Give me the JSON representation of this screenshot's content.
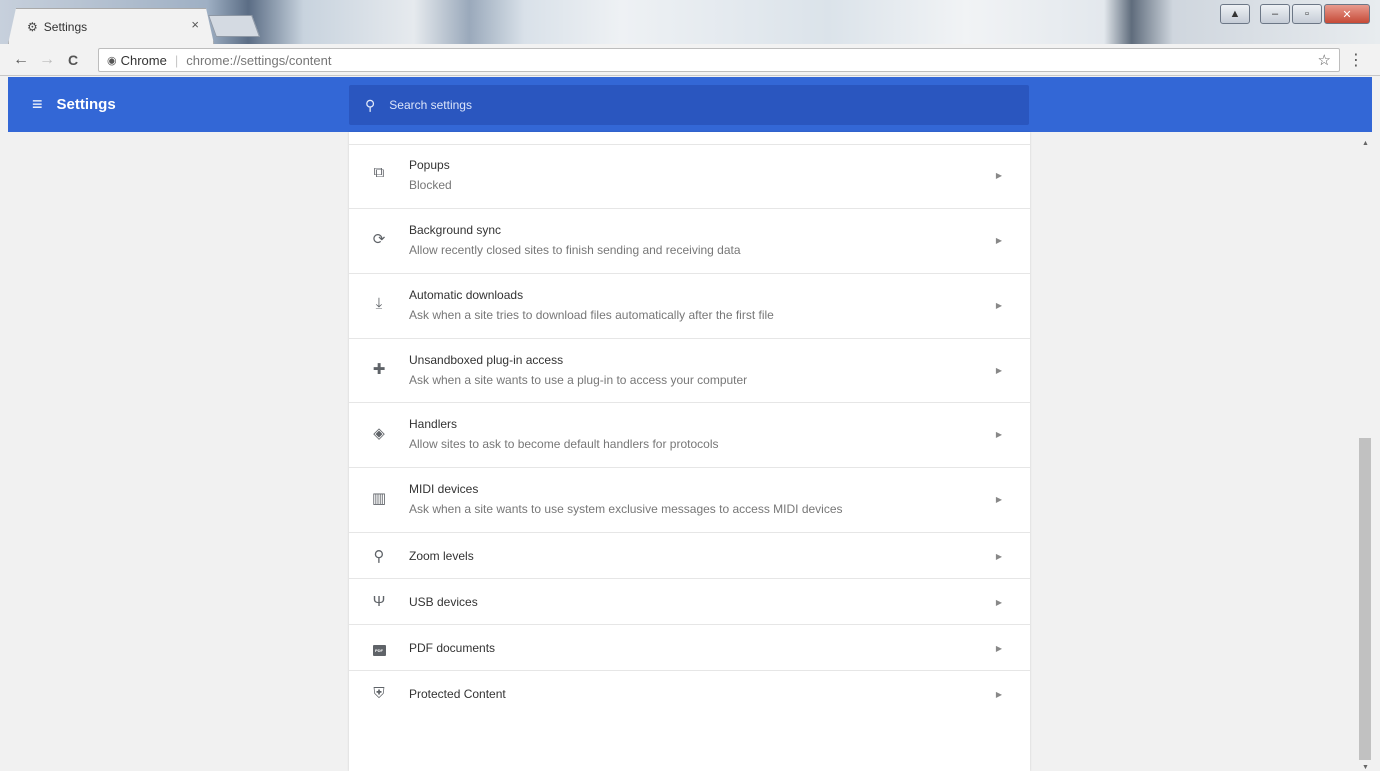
{
  "browser": {
    "tab_title": "Settings",
    "tab_close": "×",
    "back": "←",
    "forward": "→",
    "reload": "C",
    "origin": "Chrome",
    "url": "chrome://settings/content",
    "star": "☆",
    "menu": "⋮",
    "window_controls": {
      "user": "▲",
      "minimize": "–",
      "maximize": "▫",
      "close": "✕"
    }
  },
  "header": {
    "menu_icon": "≡",
    "title": "Settings",
    "search_placeholder": "Search settings"
  },
  "settings": {
    "items": [
      {
        "icon": "popup-icon",
        "glyph": "⧉",
        "label": "Popups",
        "sub": "Blocked"
      },
      {
        "icon": "sync-icon",
        "glyph": "⟳",
        "label": "Background sync",
        "sub": "Allow recently closed sites to finish sending and receiving data"
      },
      {
        "icon": "download-icon",
        "glyph": "⤓",
        "label": "Automatic downloads",
        "sub": "Ask when a site tries to download files automatically after the first file"
      },
      {
        "icon": "puzzle-icon",
        "glyph": "✚",
        "label": "Unsandboxed plug-in access",
        "sub": "Ask when a site wants to use a plug-in to access your computer"
      },
      {
        "icon": "handlers-icon",
        "glyph": "◈",
        "label": "Handlers",
        "sub": "Allow sites to ask to become default handlers for protocols"
      },
      {
        "icon": "midi-icon",
        "glyph": "▥",
        "label": "MIDI devices",
        "sub": "Ask when a site wants to use system exclusive messages to access MIDI devices"
      },
      {
        "icon": "zoom-icon",
        "glyph": "⚲",
        "label": "Zoom levels",
        "sub": ""
      },
      {
        "icon": "usb-icon",
        "glyph": "Ψ",
        "label": "USB devices",
        "sub": ""
      },
      {
        "icon": "pdf-icon",
        "glyph": "PDF",
        "label": "PDF documents",
        "sub": ""
      },
      {
        "icon": "shield-icon",
        "glyph": "⛨",
        "label": "Protected Content",
        "sub": ""
      }
    ]
  },
  "colors": {
    "header_blue": "#3367d6",
    "search_blue": "#2a56bf"
  }
}
